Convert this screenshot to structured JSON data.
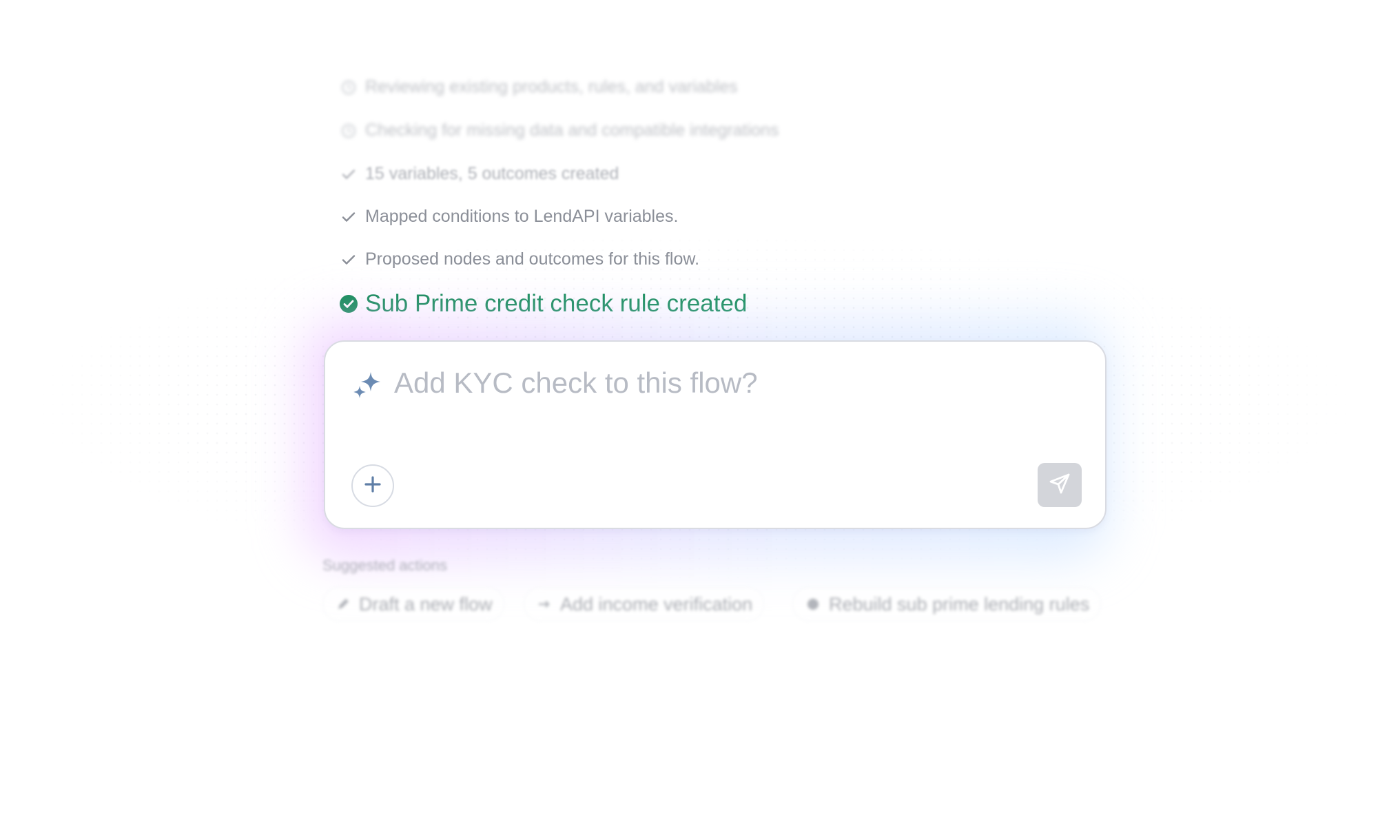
{
  "progress": {
    "steps": [
      {
        "label": "Reviewing existing products, rules, and variables",
        "status": "pending",
        "icon": "clock-icon"
      },
      {
        "label": "Checking for missing data and compatible integrations",
        "status": "pending",
        "icon": "clock-icon"
      },
      {
        "label": "15 variables, 5 outcomes created",
        "status": "done",
        "icon": "check-icon"
      },
      {
        "label": "Mapped conditions to LendAPI variables.",
        "status": "done",
        "icon": "check-icon"
      },
      {
        "label": "Proposed nodes and outcomes for this flow.",
        "status": "done",
        "icon": "check-icon"
      }
    ],
    "result": {
      "label": "Sub Prime credit check rule created",
      "icon": "check-circle-icon",
      "color": "#0f8a55"
    }
  },
  "composer": {
    "placeholder": "Add KYC check to this flow?",
    "value": "",
    "add_icon": "plus-icon",
    "send_icon": "send-icon",
    "sparkle_icon": "sparkle-icon"
  },
  "suggested": {
    "title": "Suggested actions",
    "actions": [
      {
        "label": "Draft a new flow",
        "icon": "pencil-icon"
      },
      {
        "label": "Add income verification",
        "icon": "arrow-icon"
      },
      {
        "label": "Rebuild sub prime lending rules",
        "icon": "dot-icon"
      }
    ]
  },
  "colors": {
    "success": "#0f8a55",
    "muted_text": "#8b8f98",
    "placeholder": "#b7bbc4",
    "icon_blue": "#6b8bb3"
  }
}
